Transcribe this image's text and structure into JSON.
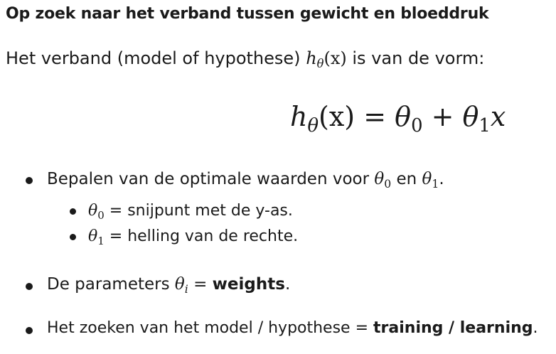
{
  "title": "Op zoek naar het verband tussen gewicht en bloeddruk",
  "intro": {
    "text": "Het verband (model of hypothese)",
    "symbol_h": "h",
    "symbol_theta": "θ",
    "arg": "(x)",
    "suffix": "is van de vorm:"
  },
  "formula": {
    "lhs_h": "h",
    "lhs_sub": "θ",
    "lhs_arg": "(x)",
    "eq": "=",
    "theta": "θ",
    "sub0": "0",
    "plus": "+",
    "sub1": "1",
    "x": "x"
  },
  "bullets": [
    {
      "prefix": "Bepalen van de optimale waarden voor",
      "theta": "θ",
      "sub_a": "0",
      "mid": "en",
      "sub_b": "1",
      "suffix": "."
    },
    {
      "theta": "θ",
      "sub": "0",
      "text": "= snijpunt met de y-as."
    },
    {
      "theta": "θ",
      "sub": "1",
      "text": "= helling van de rechte."
    },
    {
      "prefix": "De parameters",
      "theta": "θ",
      "sub": "i",
      "mid": "=",
      "bold": "weights",
      "suffix": "."
    },
    {
      "prefix": "Het zoeken van het model / hypothese =",
      "bold": "training / learning",
      "suffix": "."
    }
  ]
}
